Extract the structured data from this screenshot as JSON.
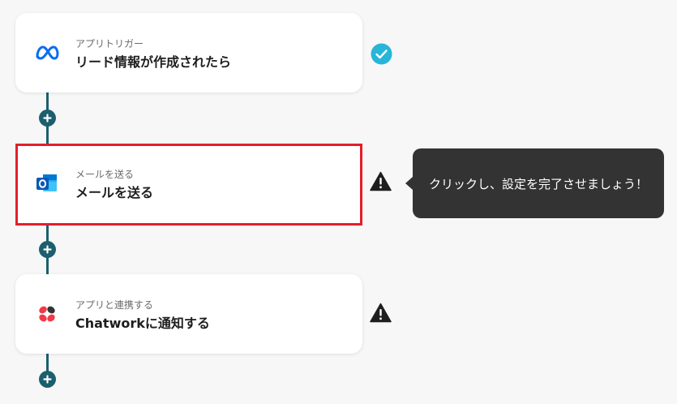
{
  "steps": [
    {
      "caption": "アプリトリガー",
      "title": "リード情報が作成されたら",
      "app_icon": "meta-icon",
      "status": "check-circle-icon",
      "status_color": "#27b5d8"
    },
    {
      "caption": "メールを送る",
      "title": "メールを送る",
      "app_icon": "outlook-icon",
      "status": "warning-icon",
      "selected": true,
      "highlight_color": "#e41e2b"
    },
    {
      "caption": "アプリと連携する",
      "title": "Chatworkに通知する",
      "app_icon": "chatwork-icon",
      "status": "warning-icon"
    }
  ],
  "add_step_icon": "plus-icon",
  "tooltip": {
    "text": "クリックし、設定を完了させましょう！"
  },
  "colors": {
    "connector": "#1b5f6e",
    "tooltip_bg": "#333333",
    "background": "#f7f7f7"
  }
}
